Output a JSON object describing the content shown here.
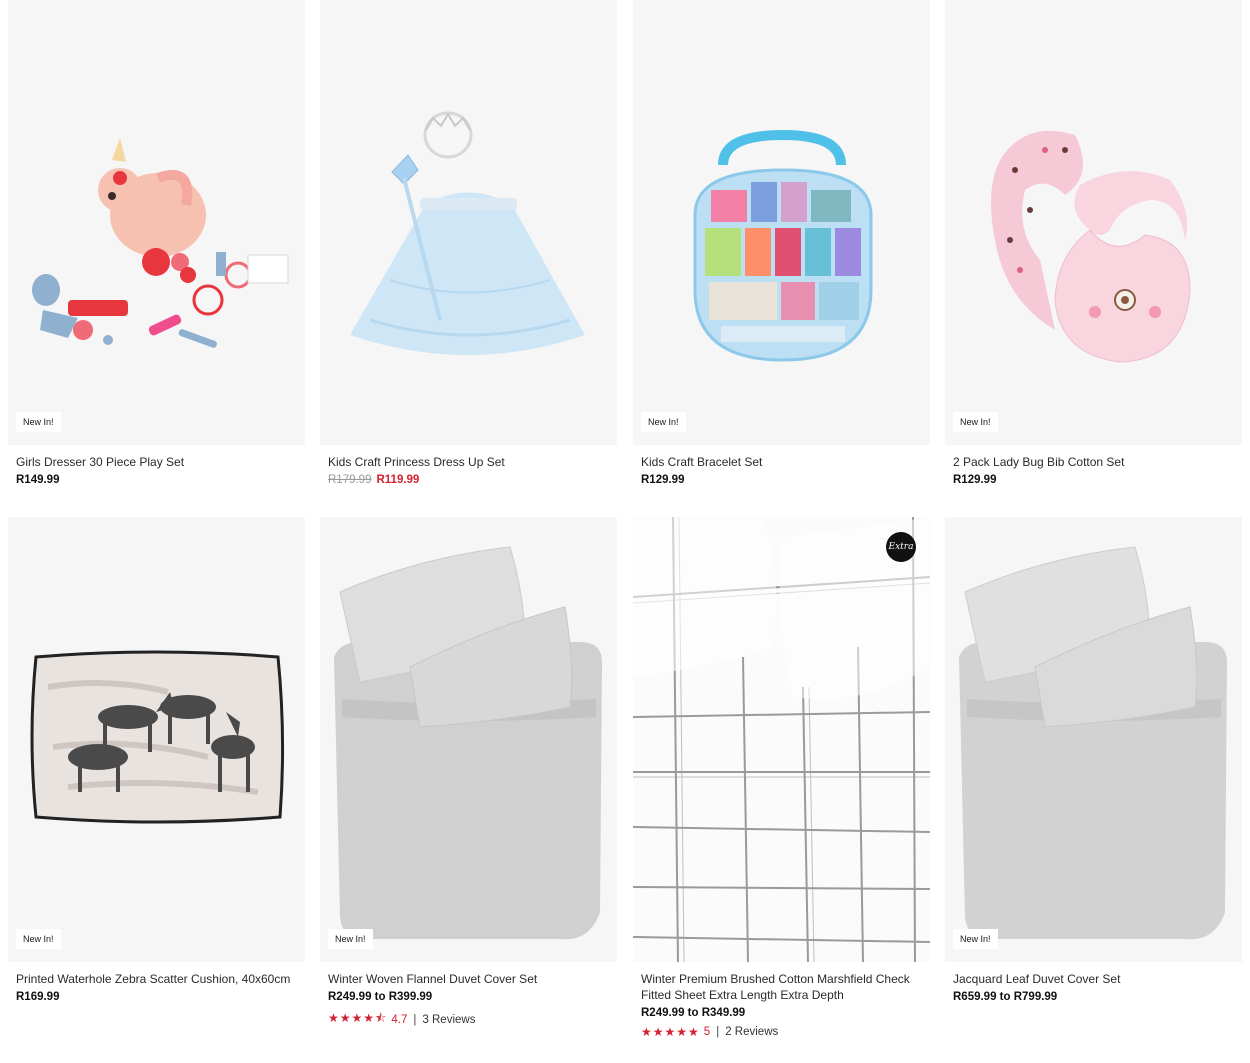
{
  "products": [
    {
      "title": "Girls Dresser 30 Piece Play Set",
      "price": "R149.99",
      "badge": "New In!"
    },
    {
      "title": "Kids Craft Princess Dress Up Set",
      "old_price": "R179.99",
      "sale_price": "R119.99"
    },
    {
      "title": "Kids Craft Bracelet Set",
      "price": "R129.99",
      "badge": "New In!"
    },
    {
      "title": "2 Pack Lady Bug Bib Cotton Set",
      "price": "R129.99",
      "badge": "New In!"
    },
    {
      "title": "Printed Waterhole Zebra Scatter Cushion, 40x60cm",
      "price": "R169.99",
      "badge": "New In!"
    },
    {
      "title": "Winter Woven Flannel Duvet Cover Set",
      "price": "R249.99 to R399.99",
      "badge": "New In!",
      "rating": "4.7",
      "stars": "★★★★⯪",
      "reviews": "3 Reviews"
    },
    {
      "title": "Winter Premium Brushed Cotton Marshfield Check Fitted Sheet Extra Length Extra Depth",
      "price": "R249.99 to R349.99",
      "extra_badge": "Extra",
      "rating": "5",
      "stars": "★★★★★",
      "reviews": "2 Reviews"
    },
    {
      "title": "Jacquard Leaf Duvet Cover Set",
      "price": "R659.99 to R799.99",
      "badge": "New In!"
    }
  ],
  "rating_separator": "|",
  "colors": {
    "sale": "#d3212f",
    "image_bg": "#f6f6f6",
    "strike": "#9a9a9a"
  }
}
